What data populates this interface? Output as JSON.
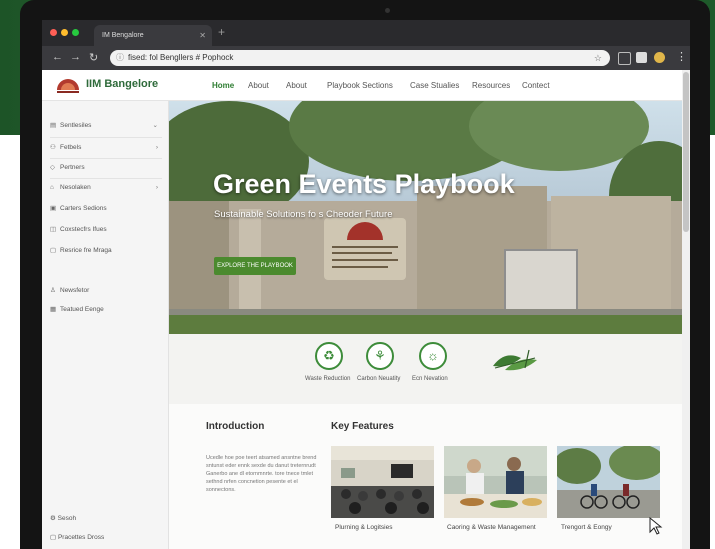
{
  "browser": {
    "tab_title": "IM Bengalore",
    "new_tab": "+",
    "url": "fised: fol Bengllers # Pophock"
  },
  "site": {
    "logo_text": "IIM Bangelore",
    "logo_caption": "IIM BLORE",
    "nav": [
      "Home",
      "About",
      "About",
      "Playbook Sections",
      "Case Stualies",
      "Resources",
      "Contect"
    ]
  },
  "sidebar": {
    "items": [
      {
        "label": "Sentlesiles",
        "icon": "document-icon",
        "chevron": true
      },
      {
        "label": "Fetbels",
        "icon": "people-icon",
        "chevron": true
      },
      {
        "label": "Pertners",
        "icon": "tag-icon",
        "chevron": false
      },
      {
        "label": "Nesolaken",
        "icon": "home-icon",
        "chevron": true
      },
      {
        "label": "Carters Sedions",
        "icon": "grid-icon",
        "chevron": false
      },
      {
        "label": "Coxstecfrs Ifues",
        "icon": "lock-icon",
        "chevron": false
      },
      {
        "label": "Resrice fre Mraga",
        "icon": "box-icon",
        "chevron": false
      },
      {
        "label": "Newsfetor",
        "icon": "person-icon",
        "chevron": false
      },
      {
        "label": "Teatued Eenge",
        "icon": "calendar-icon",
        "chevron": false
      }
    ],
    "bottom": [
      "Sesoh",
      "Pracettes Dross"
    ]
  },
  "hero": {
    "title": "Green Events Playbook",
    "subtitle": "Sustainable Solutions fo s Cheoder Future",
    "button": "EXPLORE THE PLAYBOOK"
  },
  "features": [
    {
      "label": "Waste Reduction",
      "icon": "recycle-icon"
    },
    {
      "label": "Carbon Neuatity",
      "icon": "tree-icon"
    },
    {
      "label": "Ecn Nevation",
      "icon": "bulb-icon"
    }
  ],
  "intro": {
    "heading": "Introduction",
    "text": "Ucedle hoe poe teert atsamed ansntne brend sntunst eder ennk sexde du danut treternrudt Ganerbo ane dl etornmnrte. tore tnece tmlet sethnd nrfen concnetion pesente et el sonnectons."
  },
  "key_features": {
    "heading": "Key Features",
    "cards": [
      {
        "caption": "Plurning & Logitsies"
      },
      {
        "caption": "Caoring & Waste Management"
      },
      {
        "caption": "Trengort & Eongy"
      }
    ]
  },
  "colors": {
    "brand_green": "#2e7d32",
    "button_green": "#4b8a2e",
    "backdrop_green": "#1f5a2c"
  }
}
